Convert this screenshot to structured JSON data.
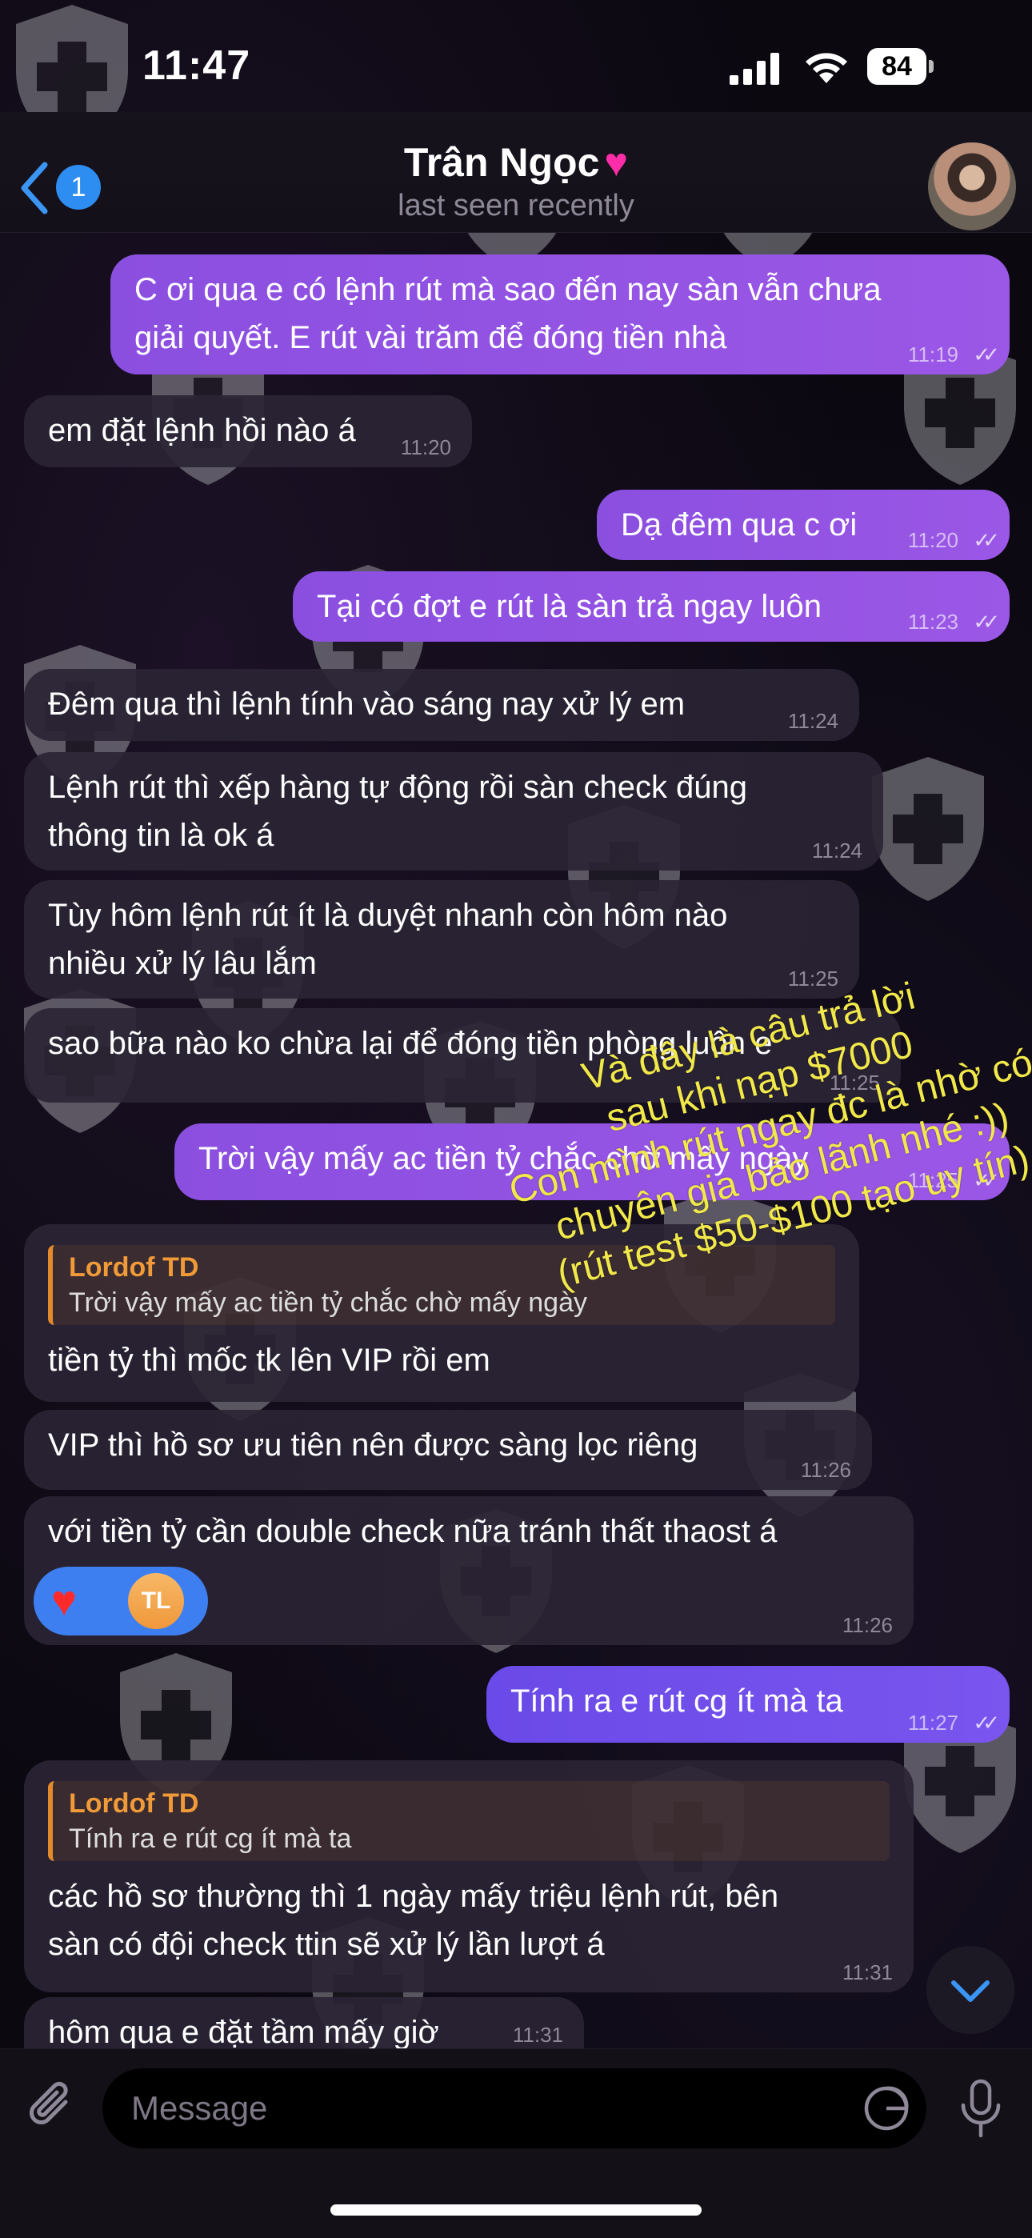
{
  "status_bar": {
    "time": "11:47",
    "battery": "84"
  },
  "header": {
    "back_count": "1",
    "contact_name": "Trân Ngọc",
    "status": "last seen recently"
  },
  "messages": [
    {
      "lines": [
        "C ơi qua e có lệnh rút mà sao đến nay sàn vẫn chưa",
        "giải quyết. E rút vài trăm để đóng tiền nhà"
      ],
      "time": "11:19"
    },
    {
      "text": "em đặt lệnh hồi nào á",
      "time": "11:20"
    },
    {
      "text": "Dạ đêm qua c ơi",
      "time": "11:20"
    },
    {
      "text": "Tại có đợt e rút là sàn trả ngay luôn",
      "time": "11:23"
    },
    {
      "text": "Đêm qua thì lệnh tính vào sáng nay xử lý em",
      "time": "11:24"
    },
    {
      "lines": [
        "Lệnh rút thì xếp hàng tự động rồi sàn check đúng",
        "thông tin là ok á"
      ],
      "time": "11:24"
    },
    {
      "lines": [
        "Tùy hôm lệnh rút ít là duyệt nhanh còn hôm nào",
        "nhiều xử lý lâu lắm"
      ],
      "time": "11:25"
    },
    {
      "text": "sao bữa nào ko chừa lại để đóng tiền phòng luôn e",
      "time": "11:25"
    },
    {
      "text": "Trời vậy mấy ac tiền tỷ chắc chờ mấy ngày",
      "time": "11:25"
    },
    {
      "reply_name": "Lordof TD",
      "reply_text": "Trời vậy mấy ac tiền tỷ chắc chờ mấy ngày",
      "text": "tiền tỷ thì mốc tk lên VIP rồi em"
    },
    {
      "text": "VIP thì hồ sơ ưu tiên nên được sàng lọc riêng",
      "time": "11:26"
    },
    {
      "text": "với tiền tỷ cần double check nữa tránh thất thaost á",
      "time": "11:26",
      "reaction_emoji": "♥",
      "reaction_user": "TL"
    },
    {
      "text": "Tính ra e rút cg ít mà ta",
      "time": "11:27"
    },
    {
      "reply_name": "Lordof TD",
      "reply_text": "Tính ra e rút cg ít mà ta",
      "lines": [
        "các hồ sơ thường thì 1 ngày mấy triệu lệnh rút, bên",
        "sàn có đội check ttin sẽ xử lý lần lượt á"
      ],
      "time": "11:31"
    },
    {
      "text": "hôm qua e đặt tầm mấy giờ",
      "time": "11:31"
    }
  ],
  "annotation": {
    "lines": [
      "Và đây là câu trả lời",
      "sau khi nạp $7000",
      "Con mình rút ngay đc là nhờ có",
      "chuyên gia bảo lãnh nhé :))",
      "(rút test $50-$100 tạo uy tín)"
    ]
  },
  "input": {
    "placeholder": "Message"
  },
  "colors": {
    "outgoing_bubble": "#8b4fe0",
    "incoming_bubble": "#2a2434",
    "reply_accent": "#e58a2c",
    "annotation": "#f1e84a",
    "badge": "#2e8df0"
  }
}
